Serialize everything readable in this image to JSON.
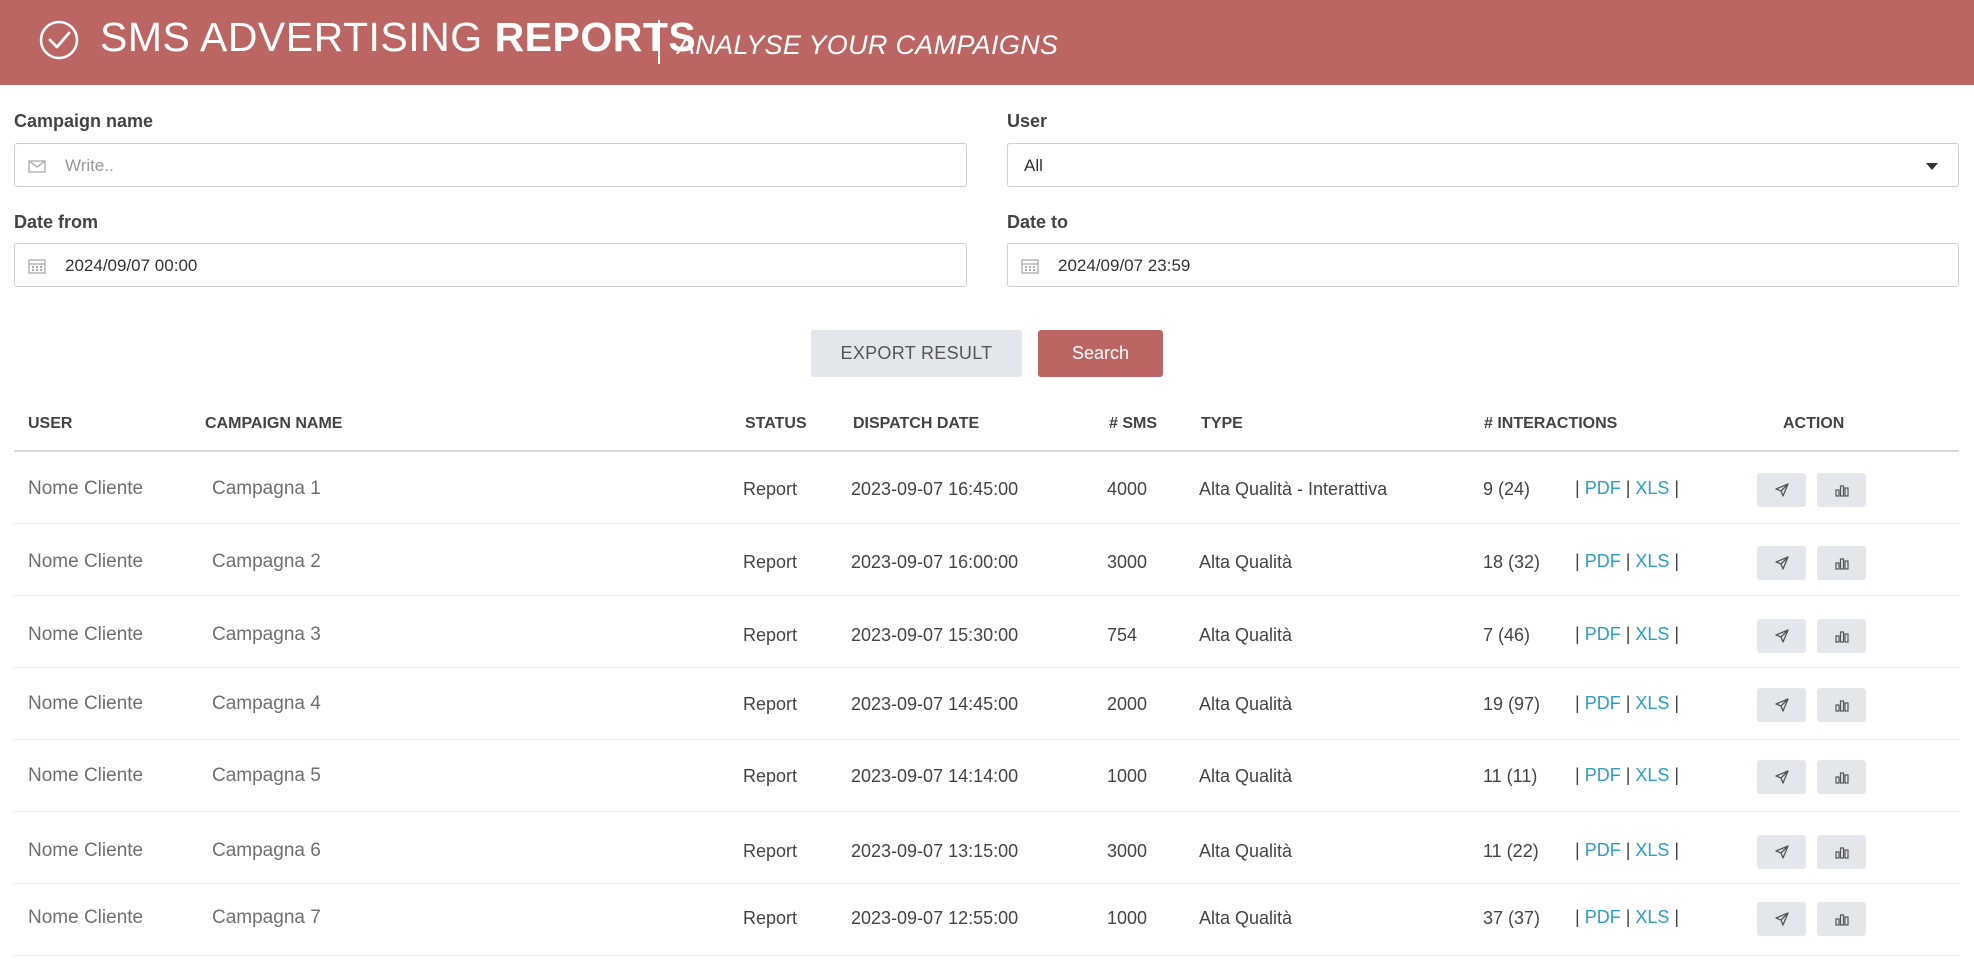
{
  "header": {
    "title_light": "SMS ADVERTISING ",
    "title_bold": "REPORTS",
    "subtitle": "ANALYSE YOUR CAMPAIGNS",
    "icon": "check-circle-icon"
  },
  "filters": {
    "campaign_name": {
      "label": "Campaign name",
      "placeholder": "Write..",
      "icon": "envelope-icon"
    },
    "user": {
      "label": "User",
      "value": "All",
      "icon": "chevron-down-icon"
    },
    "date_from": {
      "label": "Date from",
      "value": "2024/09/07 00:00",
      "icon": "calendar-icon"
    },
    "date_to": {
      "label": "Date to",
      "value": "2024/09/07 23:59",
      "icon": "calendar-icon"
    }
  },
  "buttons": {
    "export": "EXPORT RESULT",
    "search": "Search"
  },
  "table": {
    "headers": [
      "USER",
      "CAMPAIGN NAME",
      "STATUS",
      "DISPATCH DATE",
      "# SMS",
      "TYPE",
      "# INTERACTIONS",
      "ACTION"
    ],
    "link_pdf": "PDF",
    "link_xls": "XLS",
    "rows": [
      {
        "user": "Nome Cliente",
        "campaign": "Campagna 1",
        "status": "Report",
        "date": "2023-09-07 16:45:00",
        "sms": "4000",
        "type": "Alta Qualità - Interattiva",
        "interactions": "9  (24)"
      },
      {
        "user": "Nome Cliente",
        "campaign": "Campagna 2",
        "status": "Report",
        "date": "2023-09-07 16:00:00",
        "sms": "3000",
        "type": "Alta Qualità",
        "interactions": "18 (32)"
      },
      {
        "user": "Nome Cliente",
        "campaign": "Campagna 3",
        "status": "Report",
        "date": "2023-09-07 15:30:00",
        "sms": "754",
        "type": "Alta Qualità",
        "interactions": "7 (46)"
      },
      {
        "user": "Nome Cliente",
        "campaign": "Campagna 4",
        "status": "Report",
        "date": "2023-09-07 14:45:00",
        "sms": "2000",
        "type": "Alta Qualità",
        "interactions": "19 (97)"
      },
      {
        "user": "Nome Cliente",
        "campaign": "Campagna 5",
        "status": "Report",
        "date": "2023-09-07 14:14:00",
        "sms": "1000",
        "type": "Alta Qualità",
        "interactions": "11 (11)"
      },
      {
        "user": "Nome Cliente",
        "campaign": "Campagna 6",
        "status": "Report",
        "date": "2023-09-07 13:15:00",
        "sms": "3000",
        "type": "Alta Qualità",
        "interactions": "11 (22)"
      },
      {
        "user": "Nome Cliente",
        "campaign": "Campagna 7",
        "status": "Report",
        "date": "2023-09-07 12:55:00",
        "sms": "1000",
        "type": "Alta Qualità",
        "interactions": "37 (37)"
      }
    ],
    "action_icons": [
      "send-icon",
      "bar-chart-icon"
    ]
  },
  "colors": {
    "brand": "#bc6663",
    "link": "#2a9fc2",
    "button_grey": "#e3e6ea"
  }
}
